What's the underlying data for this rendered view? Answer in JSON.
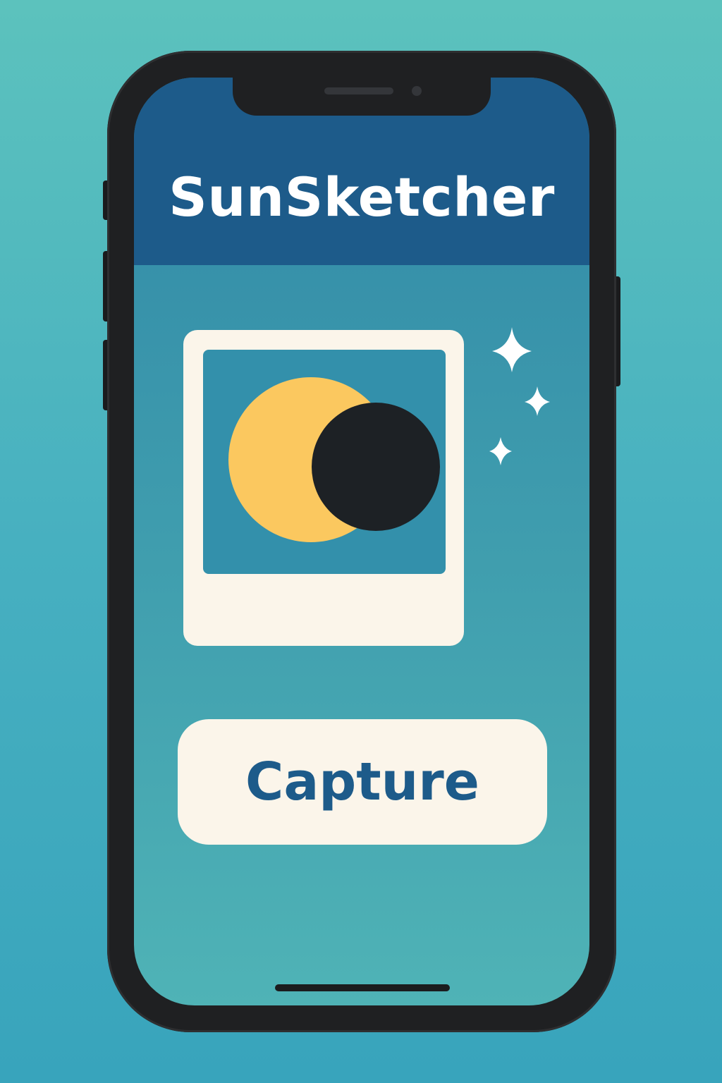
{
  "app": {
    "title": "SunSketcher"
  },
  "preview": {
    "icon": "solar-eclipse-icon",
    "decoration": "sparkles-icon"
  },
  "actions": {
    "capture_label": "Capture"
  },
  "colors": {
    "background": "#4fb3c0",
    "header": "#1d5b8a",
    "screen": "#3a96ad",
    "frame": "#fbf5ea",
    "sun": "#fbc85f",
    "moon": "#1d2125",
    "accent_text": "#1d5b8a"
  }
}
